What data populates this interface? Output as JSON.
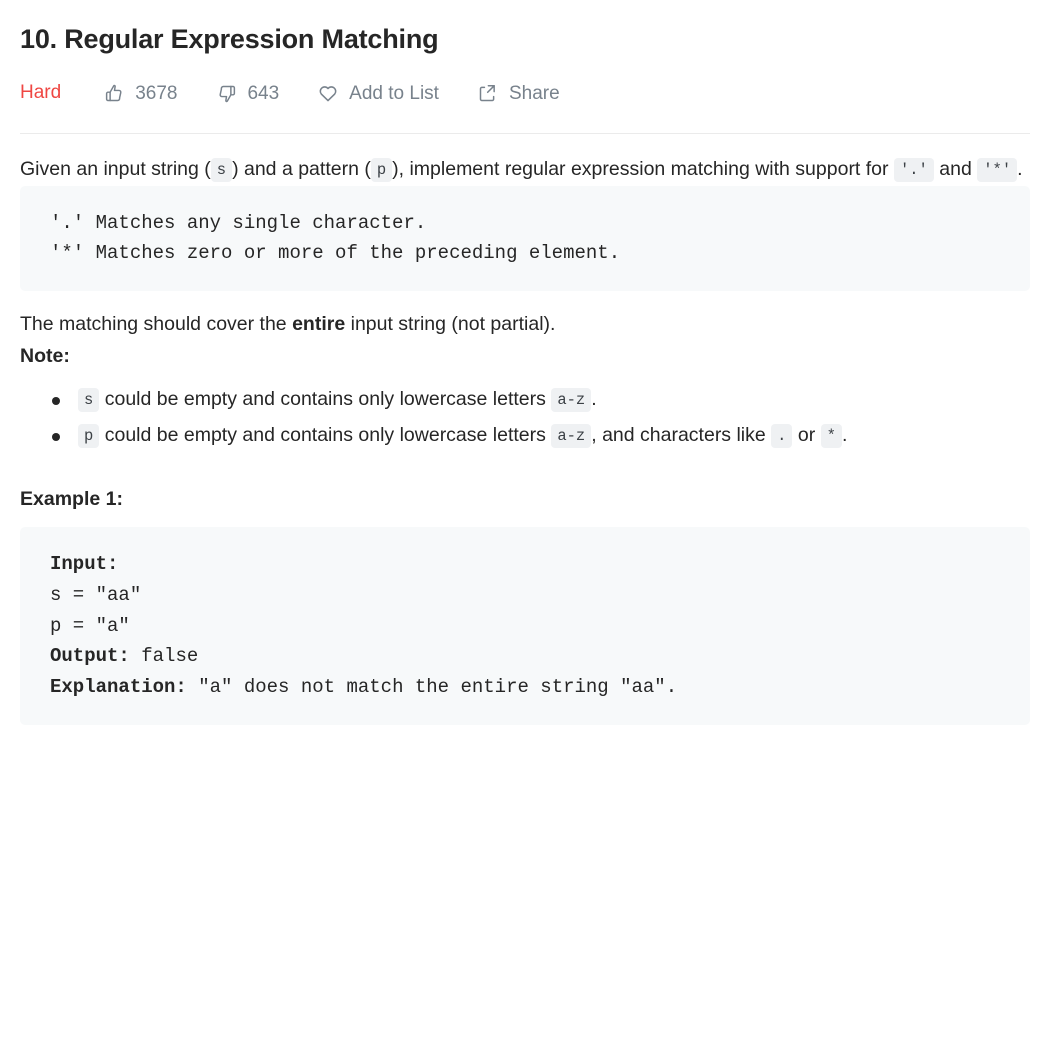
{
  "problem": {
    "title": "10. Regular Expression Matching",
    "difficulty": "Hard",
    "difficulty_color": "#ef4743"
  },
  "meta_actions": {
    "likes": {
      "icon": "thumbs-up-icon",
      "count": "3678"
    },
    "dislikes": {
      "icon": "thumbs-down-icon",
      "count": "643"
    },
    "add_to_list": {
      "icon": "heart-icon",
      "label": "Add to List"
    },
    "share": {
      "icon": "share-icon",
      "label": "Share"
    }
  },
  "description": {
    "intro_part1": "Given an input string (",
    "intro_code_s": "s",
    "intro_part2": ") and a pattern (",
    "intro_code_p": "p",
    "intro_part3": "), implement regular expression matching with support for",
    "intro_code_dot": "'.'",
    "intro_and": "and",
    "intro_code_star": "'*'",
    "intro_end": ".",
    "rules_block": "'.' Matches any single character.\n'*' Matches zero or more of the preceding element.",
    "coverage_part1": "The matching should cover the",
    "coverage_emphasis": "entire",
    "coverage_part2": "input string (not partial)."
  },
  "note": {
    "heading": "Note:",
    "items": [
      {
        "code_var": "s",
        "text_before_range": "could be empty and contains only lowercase letters",
        "code_range": "a-z",
        "text_after": "."
      },
      {
        "code_var": "p",
        "text_before_range": "could be empty and contains only lowercase letters",
        "code_range": "a-z",
        "text_after": ", and characters like",
        "code_dot": ".",
        "or_text": "or",
        "code_star": "*",
        "end_text": "."
      }
    ]
  },
  "example": {
    "heading": "Example 1:",
    "input_label": "Input:",
    "s_line": "s = \"aa\"",
    "p_line": "p = \"a\"",
    "output_label": "Output:",
    "output_value": "false",
    "explanation_label": "Explanation:",
    "explanation_value": "\"a\" does not match the entire string \"aa\"."
  },
  "colors": {
    "text": "#262626",
    "muted": "#78828c",
    "code_bg": "#f7f9fa",
    "inline_code_bg": "#eff1f3",
    "divider": "#ebebeb"
  }
}
